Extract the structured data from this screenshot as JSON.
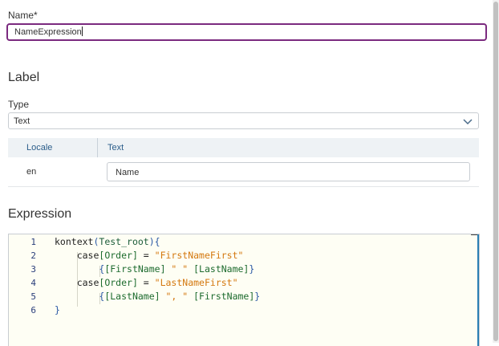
{
  "name_field": {
    "label": "Name*",
    "value": "NameExpression"
  },
  "label_section": {
    "title": "Label"
  },
  "type_field": {
    "label": "Type",
    "selected": "Text",
    "icon": "chevron-down-icon"
  },
  "locale_table": {
    "headers": [
      "Locale",
      "Text"
    ],
    "rows": [
      {
        "locale": "en",
        "text": "Name"
      }
    ]
  },
  "expression_section": {
    "title": "Expression"
  },
  "code_editor": {
    "line_numbers": [
      "1",
      "2",
      "3",
      "4",
      "5",
      "6"
    ],
    "lines": [
      "kontext(Test_root){",
      "    case[Order] = \"FirstNameFirst\"",
      "        {[FirstName] \" \" [LastName]}",
      "    case[Order] = \"LastNameFirst\"",
      "        {[LastName] \", \" [FirstName]}",
      "}"
    ],
    "tokens": {
      "l1": [
        "kontext",
        "(",
        "Test_root",
        "){"
      ],
      "l2": [
        "case",
        "[Order]",
        " = ",
        "\"FirstNameFirst\""
      ],
      "l3": [
        "{",
        "[FirstName]",
        " \" \" ",
        "[LastName]",
        "}"
      ],
      "l4": [
        "case",
        "[Order]",
        " = ",
        "\"LastNameFirst\""
      ],
      "l5": [
        "{",
        "[LastName]",
        " \", \" ",
        "[FirstName]",
        "}"
      ],
      "l6": [
        "}"
      ]
    }
  },
  "colors": {
    "focus_border": "#7b2a7f",
    "header_text": "#2b5d8a",
    "string": "#d4780f",
    "field": "#1d6b2e",
    "editor_bg": "#fefef4"
  }
}
